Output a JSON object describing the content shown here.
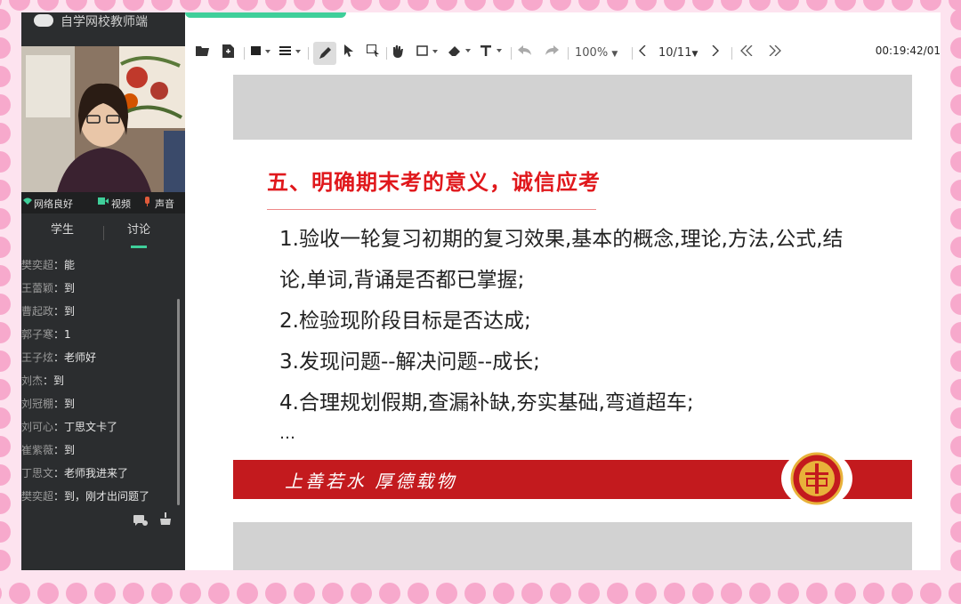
{
  "app": {
    "name": "自学网校教师端"
  },
  "status": {
    "network": "网络良好",
    "video": "视频",
    "audio": "声音"
  },
  "tabs": [
    {
      "label": "学生"
    },
    {
      "label": "讨论"
    }
  ],
  "chat": [
    {
      "name": "樊奕超",
      "sep": "：",
      "text": "能"
    },
    {
      "name": "王蕾颖",
      "sep": "：",
      "text": "到"
    },
    {
      "name": "曹起政",
      "sep": "：",
      "text": "到"
    },
    {
      "name": "郭子寒",
      "sep": "：",
      "text": "1"
    },
    {
      "name": "王子炫",
      "sep": "：",
      "text": "老师好"
    },
    {
      "name": "刘杰",
      "sep": "：",
      "text": "到"
    },
    {
      "name": "刘冠棚",
      "sep": "：",
      "text": "到"
    },
    {
      "name": "刘可心",
      "sep": "：",
      "text": "丁思文卡了"
    },
    {
      "name": "崔紫薇",
      "sep": "：",
      "text": "到"
    },
    {
      "name": "丁思文",
      "sep": "：",
      "text": "老师我进来了"
    },
    {
      "name": "樊奕超",
      "sep": "：",
      "text": "到，刚才出问题了"
    }
  ],
  "toolbar": {
    "zoom": "100%",
    "page": "10/11",
    "time": "00:19:42/01",
    "icons": [
      "open-file-icon",
      "new-file-icon",
      "fill-color-icon",
      "line-style-icon",
      "pen-icon",
      "pointer-icon",
      "select-icon",
      "hand-icon",
      "rectangle-icon",
      "eraser-icon",
      "text-icon",
      "undo-icon",
      "redo-icon"
    ]
  },
  "slide": {
    "title": "五、明确期末考的意义，诚信应考",
    "lines": [
      "1.验收一轮复习初期的复习效果,基本的概念,理论,方法,公式,结",
      "论,单词,背诵是否都已掌握;",
      "2.检验现阶段目标是否达成;",
      "3.发现问题--解决问题--成长;",
      "4.合理规划假期,查漏补缺,夯实基础,弯道超车;",
      "…"
    ],
    "motto": "上善若水  厚德载物",
    "colors": {
      "title": "#e0181c",
      "band": "#c31a1e"
    }
  },
  "colors": {
    "accent": "#3fcf9a",
    "panel": "#2b2d2f",
    "frame_dots": "#f7a9cc"
  }
}
